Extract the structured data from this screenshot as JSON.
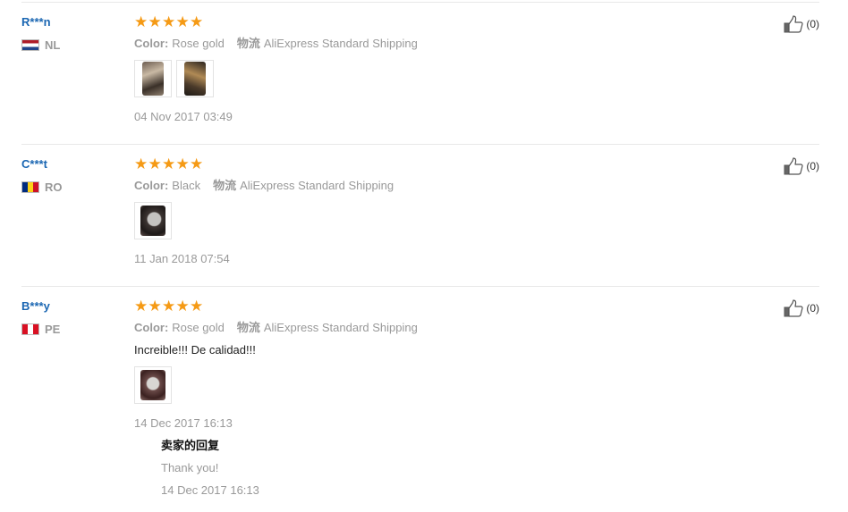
{
  "labels": {
    "color": "Color:",
    "logistics": "物流",
    "seller_reply_title": "卖家的回复"
  },
  "colors": {
    "accent_link": "#1a66b2",
    "star": "#f59a15",
    "muted": "#999999"
  },
  "reviews": [
    {
      "user": "R***n",
      "country": "NL",
      "rating": 5,
      "color_value": "Rose gold",
      "shipping": "AliExpress Standard Shipping",
      "feedback": "",
      "photos": 2,
      "date": "04 Nov 2017 03:49",
      "helpful": "(0)"
    },
    {
      "user": "C***t",
      "country": "RO",
      "rating": 5,
      "color_value": "Black",
      "shipping": "AliExpress Standard Shipping",
      "feedback": "",
      "photos": 1,
      "date": "11 Jan 2018 07:54",
      "helpful": "(0)"
    },
    {
      "user": "B***y",
      "country": "PE",
      "rating": 5,
      "color_value": "Rose gold",
      "shipping": "AliExpress Standard Shipping",
      "feedback": "Increible!!! De calidad!!!",
      "photos": 1,
      "date": "14 Dec 2017 16:13",
      "helpful": "(0)",
      "reply": {
        "text": "Thank you!",
        "date": "14 Dec 2017 16:13"
      }
    }
  ]
}
